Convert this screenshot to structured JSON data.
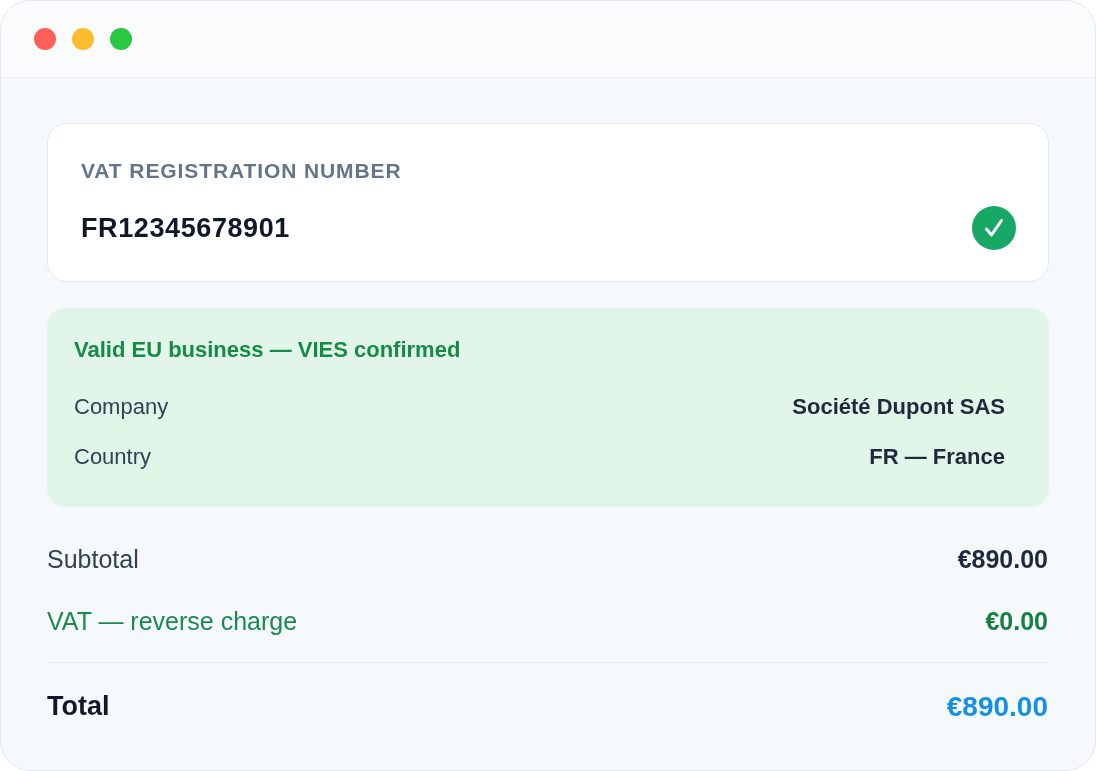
{
  "vat_field": {
    "label": "VAT REGISTRATION NUMBER",
    "value": "FR12345678901",
    "valid": true
  },
  "verification": {
    "title": "Valid EU business — VIES confirmed",
    "rows": [
      {
        "label": "Company",
        "value": "Société Dupont SAS"
      },
      {
        "label": "Country",
        "value": "FR — France"
      }
    ]
  },
  "summary": [
    {
      "kind": "line",
      "label": "Subtotal",
      "value": "€890.00"
    },
    {
      "kind": "exempt",
      "label": "VAT — reverse charge",
      "value": "€0.00"
    },
    {
      "kind": "total",
      "label": "Total",
      "value": "€890.00"
    }
  ]
}
